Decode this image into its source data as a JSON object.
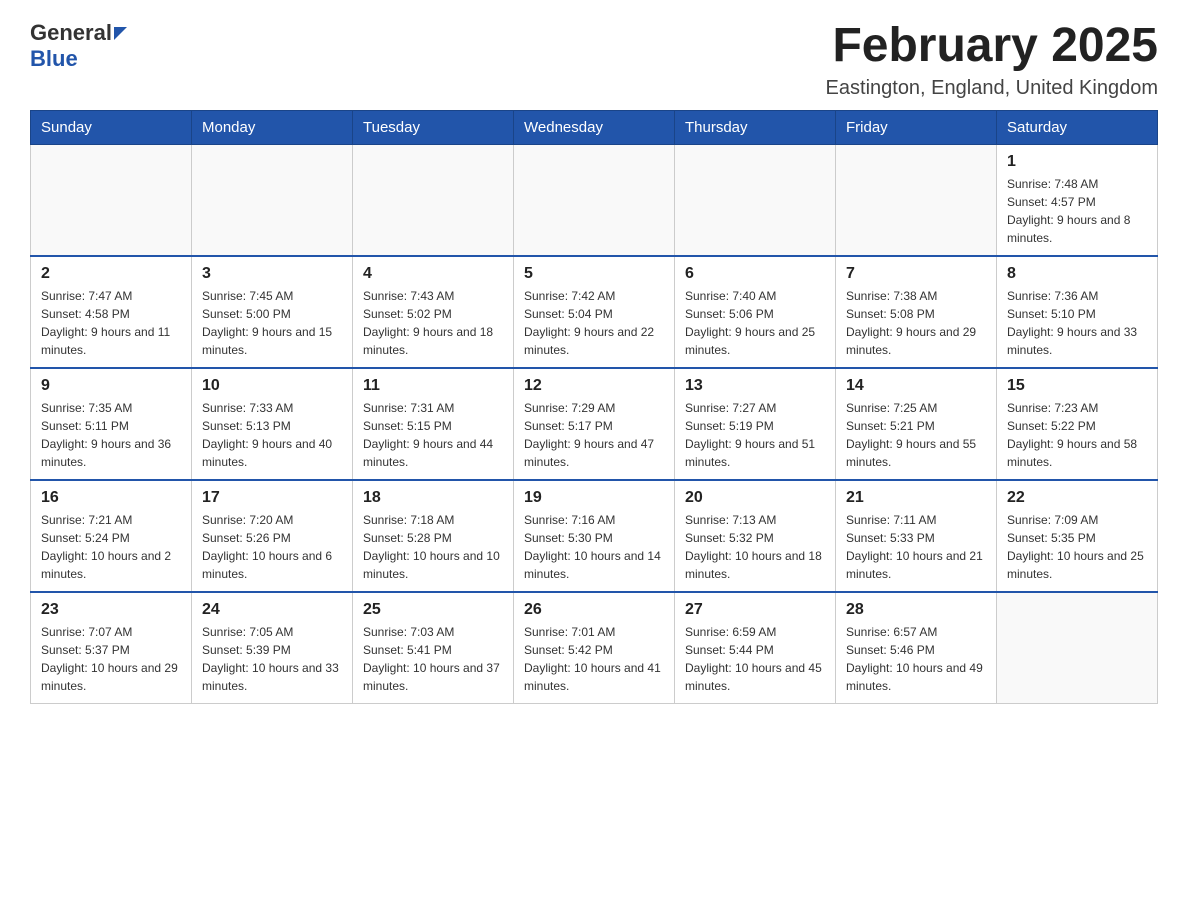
{
  "header": {
    "logo_general": "General",
    "logo_blue": "Blue",
    "month_title": "February 2025",
    "location": "Eastington, England, United Kingdom"
  },
  "weekdays": [
    "Sunday",
    "Monday",
    "Tuesday",
    "Wednesday",
    "Thursday",
    "Friday",
    "Saturday"
  ],
  "weeks": [
    [
      {
        "day": "",
        "info": ""
      },
      {
        "day": "",
        "info": ""
      },
      {
        "day": "",
        "info": ""
      },
      {
        "day": "",
        "info": ""
      },
      {
        "day": "",
        "info": ""
      },
      {
        "day": "",
        "info": ""
      },
      {
        "day": "1",
        "info": "Sunrise: 7:48 AM\nSunset: 4:57 PM\nDaylight: 9 hours and 8 minutes."
      }
    ],
    [
      {
        "day": "2",
        "info": "Sunrise: 7:47 AM\nSunset: 4:58 PM\nDaylight: 9 hours and 11 minutes."
      },
      {
        "day": "3",
        "info": "Sunrise: 7:45 AM\nSunset: 5:00 PM\nDaylight: 9 hours and 15 minutes."
      },
      {
        "day": "4",
        "info": "Sunrise: 7:43 AM\nSunset: 5:02 PM\nDaylight: 9 hours and 18 minutes."
      },
      {
        "day": "5",
        "info": "Sunrise: 7:42 AM\nSunset: 5:04 PM\nDaylight: 9 hours and 22 minutes."
      },
      {
        "day": "6",
        "info": "Sunrise: 7:40 AM\nSunset: 5:06 PM\nDaylight: 9 hours and 25 minutes."
      },
      {
        "day": "7",
        "info": "Sunrise: 7:38 AM\nSunset: 5:08 PM\nDaylight: 9 hours and 29 minutes."
      },
      {
        "day": "8",
        "info": "Sunrise: 7:36 AM\nSunset: 5:10 PM\nDaylight: 9 hours and 33 minutes."
      }
    ],
    [
      {
        "day": "9",
        "info": "Sunrise: 7:35 AM\nSunset: 5:11 PM\nDaylight: 9 hours and 36 minutes."
      },
      {
        "day": "10",
        "info": "Sunrise: 7:33 AM\nSunset: 5:13 PM\nDaylight: 9 hours and 40 minutes."
      },
      {
        "day": "11",
        "info": "Sunrise: 7:31 AM\nSunset: 5:15 PM\nDaylight: 9 hours and 44 minutes."
      },
      {
        "day": "12",
        "info": "Sunrise: 7:29 AM\nSunset: 5:17 PM\nDaylight: 9 hours and 47 minutes."
      },
      {
        "day": "13",
        "info": "Sunrise: 7:27 AM\nSunset: 5:19 PM\nDaylight: 9 hours and 51 minutes."
      },
      {
        "day": "14",
        "info": "Sunrise: 7:25 AM\nSunset: 5:21 PM\nDaylight: 9 hours and 55 minutes."
      },
      {
        "day": "15",
        "info": "Sunrise: 7:23 AM\nSunset: 5:22 PM\nDaylight: 9 hours and 58 minutes."
      }
    ],
    [
      {
        "day": "16",
        "info": "Sunrise: 7:21 AM\nSunset: 5:24 PM\nDaylight: 10 hours and 2 minutes."
      },
      {
        "day": "17",
        "info": "Sunrise: 7:20 AM\nSunset: 5:26 PM\nDaylight: 10 hours and 6 minutes."
      },
      {
        "day": "18",
        "info": "Sunrise: 7:18 AM\nSunset: 5:28 PM\nDaylight: 10 hours and 10 minutes."
      },
      {
        "day": "19",
        "info": "Sunrise: 7:16 AM\nSunset: 5:30 PM\nDaylight: 10 hours and 14 minutes."
      },
      {
        "day": "20",
        "info": "Sunrise: 7:13 AM\nSunset: 5:32 PM\nDaylight: 10 hours and 18 minutes."
      },
      {
        "day": "21",
        "info": "Sunrise: 7:11 AM\nSunset: 5:33 PM\nDaylight: 10 hours and 21 minutes."
      },
      {
        "day": "22",
        "info": "Sunrise: 7:09 AM\nSunset: 5:35 PM\nDaylight: 10 hours and 25 minutes."
      }
    ],
    [
      {
        "day": "23",
        "info": "Sunrise: 7:07 AM\nSunset: 5:37 PM\nDaylight: 10 hours and 29 minutes."
      },
      {
        "day": "24",
        "info": "Sunrise: 7:05 AM\nSunset: 5:39 PM\nDaylight: 10 hours and 33 minutes."
      },
      {
        "day": "25",
        "info": "Sunrise: 7:03 AM\nSunset: 5:41 PM\nDaylight: 10 hours and 37 minutes."
      },
      {
        "day": "26",
        "info": "Sunrise: 7:01 AM\nSunset: 5:42 PM\nDaylight: 10 hours and 41 minutes."
      },
      {
        "day": "27",
        "info": "Sunrise: 6:59 AM\nSunset: 5:44 PM\nDaylight: 10 hours and 45 minutes."
      },
      {
        "day": "28",
        "info": "Sunrise: 6:57 AM\nSunset: 5:46 PM\nDaylight: 10 hours and 49 minutes."
      },
      {
        "day": "",
        "info": ""
      }
    ]
  ]
}
